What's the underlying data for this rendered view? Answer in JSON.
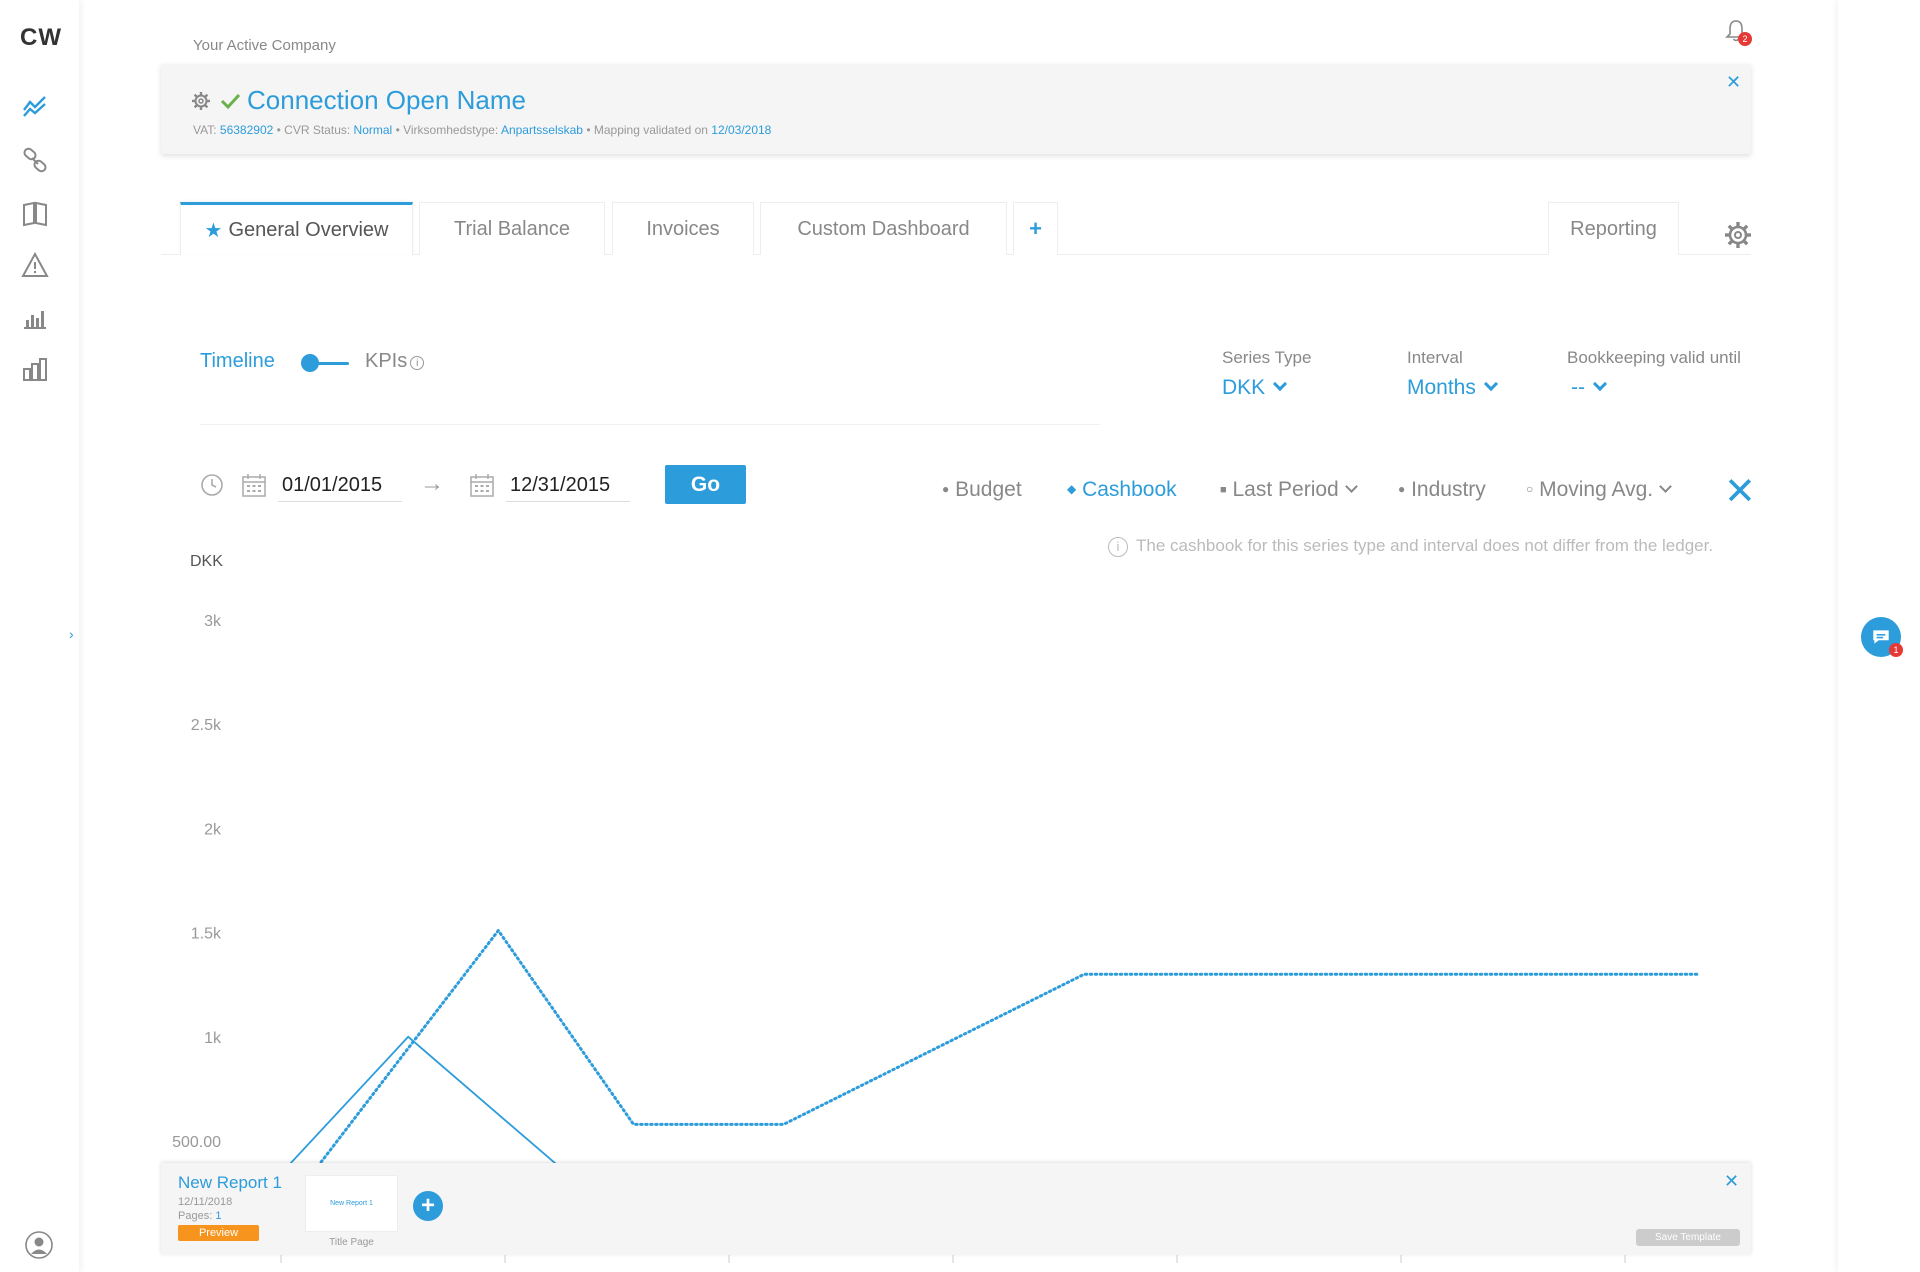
{
  "app": {
    "logo": "CW"
  },
  "sidebar": {
    "items": [
      {
        "name": "analytics",
        "icon": "trend-chart-icon"
      },
      {
        "name": "connections",
        "icon": "link-icon"
      },
      {
        "name": "ledger",
        "icon": "book-icon"
      },
      {
        "name": "warnings",
        "icon": "warning-icon"
      },
      {
        "name": "reports",
        "icon": "bar-chart-icon"
      },
      {
        "name": "dashboards",
        "icon": "blocks-icon"
      }
    ]
  },
  "notifications": {
    "count": "2"
  },
  "chat": {
    "count": "1"
  },
  "company": {
    "section_label": "Your Active Company",
    "name": "Connection Open Name",
    "vat_label": "VAT:",
    "vat": "56382902",
    "cvr_label": "• CVR Status:",
    "cvr": "Normal",
    "type_label": "• Virksomhedstype:",
    "type": "Anpartsselskab",
    "mapping_label": "• Mapping validated on",
    "mapping_date": "12/03/2018"
  },
  "tabs": [
    {
      "label": "General Overview",
      "active": true
    },
    {
      "label": "Trial Balance"
    },
    {
      "label": "Invoices"
    },
    {
      "label": "Custom Dashboard"
    },
    {
      "label": "+"
    }
  ],
  "reporting_tab": "Reporting",
  "view": {
    "timeline_label": "Timeline",
    "kpis_label": "KPIs",
    "series_type": {
      "label": "Series Type",
      "value": "DKK"
    },
    "interval": {
      "label": "Interval",
      "value": "Months"
    },
    "bookkeeping": {
      "label": "Bookkeeping valid until",
      "value": "--"
    }
  },
  "dates": {
    "from": "01/01/2015",
    "to": "12/31/2015",
    "go": "Go"
  },
  "legend": {
    "budget": "Budget",
    "cashbook": "Cashbook",
    "last_period": "Last Period",
    "industry": "Industry",
    "moving_avg": "Moving Avg.",
    "note": "The cashbook for this series type and interval does not differ from the ledger."
  },
  "chart_data": {
    "type": "line",
    "ylabel": "DKK",
    "yticks": [
      "500.00",
      "1k",
      "1.5k",
      "2k",
      "2.5k",
      "3k"
    ],
    "ylim": [
      500,
      3000
    ],
    "colors": {
      "series": "#2d9cdb"
    },
    "series": [
      {
        "name": "Ledger",
        "style": "solid",
        "x": [
          0.2,
          1,
          2
        ],
        "values": [
          380,
          1000,
          380
        ]
      },
      {
        "name": "Cashbook",
        "style": "dotted",
        "x": [
          0.4,
          1.6,
          2.5,
          3.5,
          5.5,
          6.2,
          9.6
        ],
        "values": [
          380,
          1510,
          580,
          580,
          1300,
          1300,
          1300
        ]
      }
    ],
    "xlim": [
      0,
      10
    ]
  },
  "report": {
    "title": "New Report 1",
    "date": "12/11/2018",
    "pages_label": "Pages:",
    "pages": "1",
    "preview": "Preview",
    "thumb_text": "New Report 1",
    "page_caption": "Title Page",
    "save_template": "Save Template"
  }
}
